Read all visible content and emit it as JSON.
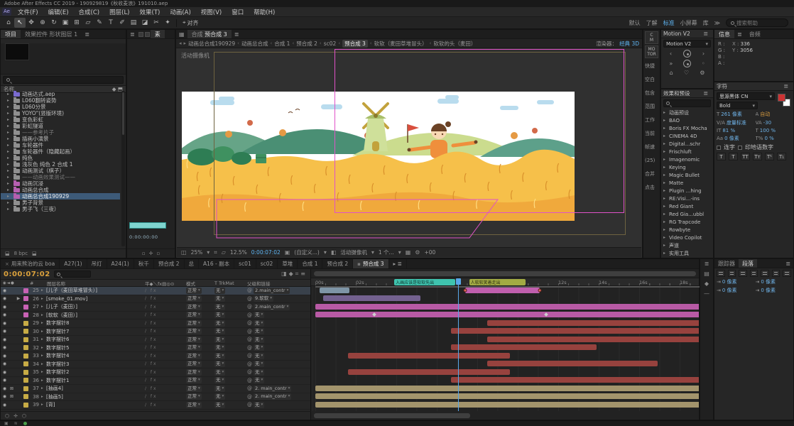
{
  "titlebar": {
    "title": "Adobe After Effects CC 2019 - 190929819《秋收麦浪》191010.aep"
  },
  "menubar": [
    "文件(F)",
    "编辑(E)",
    "合成(C)",
    "图层(L)",
    "效果(T)",
    "动画(A)",
    "视图(V)",
    "窗口",
    "帮助(H)"
  ],
  "toolbar": {
    "tools": [
      {
        "name": "home",
        "glyph": "⌂"
      },
      {
        "name": "selection",
        "glyph": "↖"
      },
      {
        "name": "hand",
        "glyph": "✥"
      },
      {
        "name": "zoom",
        "glyph": "⊕"
      },
      {
        "name": "orbit",
        "glyph": "↻"
      },
      {
        "name": "camera",
        "glyph": "▣"
      },
      {
        "name": "pan-behind",
        "glyph": "⊞"
      },
      {
        "name": "shape",
        "glyph": "▱"
      },
      {
        "name": "pen",
        "glyph": "✎"
      },
      {
        "name": "type",
        "glyph": "T"
      },
      {
        "name": "brush",
        "glyph": "✐"
      },
      {
        "name": "clone-stamp",
        "glyph": "▤"
      },
      {
        "name": "eraser",
        "glyph": "◪"
      },
      {
        "name": "roto-brush",
        "glyph": "✂"
      },
      {
        "name": "puppet",
        "glyph": "✦"
      }
    ],
    "snap_label": "对齐",
    "workspaces": [
      "默认",
      "了解",
      "标准",
      "小屏幕",
      "库"
    ],
    "active_workspace": "标准",
    "more_glyph": "≫",
    "search_placeholder": "搜索帮助"
  },
  "project": {
    "tabs": [
      {
        "label": "项目",
        "active": true
      },
      {
        "label": "效果控件 形状图层 1",
        "active": false
      }
    ],
    "name_header": "名称",
    "bitdepth": "8 bpc",
    "items": [
      {
        "name": "动画达式.aep",
        "icon": "aep"
      },
      {
        "name": "L060翻转姿势",
        "icon": "folder"
      },
      {
        "name": "L060分景",
        "icon": "folder"
      },
      {
        "name": "YOYO\"(竖版环境)",
        "icon": "folder"
      },
      {
        "name": "变色彩虹",
        "icon": "folder"
      },
      {
        "name": "彩虹隧道",
        "icon": "folder"
      },
      {
        "name": "——参考片子",
        "icon": "folder",
        "dim": true
      },
      {
        "name": "插画小演景",
        "icon": "folder"
      },
      {
        "name": "车轮器件",
        "icon": "folder"
      },
      {
        "name": "车轮器件（隐藏起画）",
        "icon": "folder"
      },
      {
        "name": "纯色",
        "icon": "folder"
      },
      {
        "name": "浅灰色 纯色 2 合成 1",
        "icon": "folder"
      },
      {
        "name": "动画测试（棋子）",
        "icon": "folder"
      },
      {
        "name": "——动画效果测试——",
        "icon": "folder",
        "dim": true
      },
      {
        "name": "动画沉浸",
        "icon": "comp"
      },
      {
        "name": "动画总合成",
        "icon": "comp"
      },
      {
        "name": "动画总合成190929",
        "icon": "comp",
        "selected": true
      },
      {
        "name": "男子背景",
        "icon": "folder"
      },
      {
        "name": "男子飞（三夜）",
        "icon": "folder"
      }
    ]
  },
  "footage": {
    "tab": "素",
    "time": "0:00:00:00"
  },
  "viewer": {
    "tab_prefix": "合成",
    "tab_name": "预合成 3",
    "breadcrumbs": [
      "动画总合成190929",
      "动画总合成",
      "合成 1",
      "预合成 2",
      "sc02",
      "预合成 3",
      "软软（麦田草堆冒头）",
      "软软的头（麦田）"
    ],
    "active_crumb": "预合成 3",
    "renderer_label": "渲染器：",
    "renderer_value": "经典 3D",
    "camera_label": "活动摄像机",
    "statusbar": {
      "zoom": "25%",
      "resolution": "12.5%",
      "time": "0:00:07:02",
      "camera_preset": "(自定义...)",
      "view_name": "活动摄像机",
      "view_count": "1 个...",
      "exposure": "+00"
    }
  },
  "motion_panel": {
    "strip_boxes": [
      "C M",
      "MO TOR"
    ],
    "title": "Motion V2",
    "preset": "Motion V2"
  },
  "preview_labels": [
    "快捷",
    "空白",
    "包含",
    "范围",
    "工作",
    "当前",
    "帧速",
    "(25)",
    "合并",
    "点击"
  ],
  "effects": {
    "title": "效果和预设",
    "groups": [
      "动画预设",
      "BAO",
      "Boris FX Mocha",
      "CINEMA 4D",
      "Digital...schr",
      "Frischluft",
      "Imagenomic",
      "Keying",
      "Magic Bullet",
      "Matte",
      "Plugin ...hing",
      "RE:Visi...-ins",
      "Red Giant",
      "Red Gia...ubbl",
      "RG Trapcode",
      "Rowbyte",
      "Video Copilot",
      "声道",
      "实用工具"
    ]
  },
  "info": {
    "tabs": [
      "信息",
      "音频"
    ],
    "channels": [
      "R :",
      "G :",
      "B :",
      "A :"
    ],
    "x_label": "X :",
    "x_value": "336",
    "y_label": "Y :",
    "y_value": "3056"
  },
  "character": {
    "title": "字符",
    "font_family": "思源黑体 CN",
    "font_style": "Bold",
    "rows": [
      {
        "li": "T",
        "lv": "261 像素",
        "ri": "A",
        "rv": "自动",
        "orange": true
      },
      {
        "li": "V/A",
        "lv": "度量标准",
        "ri": "VA",
        "rv": "-30"
      },
      {
        "li": "IT",
        "lv": "81 %",
        "ri": "T",
        "rv": "100 %"
      },
      {
        "li": "Aa",
        "lv": "0 像素",
        "ri": "T%",
        "rv": "0 %"
      }
    ],
    "checks": [
      "连字",
      "印地语数字"
    ],
    "tbuttons": [
      "T",
      "T",
      "TT",
      "Tт",
      "T¹",
      "T₁"
    ]
  },
  "paragraph": {
    "tabs": [
      "跟踪器",
      "段落"
    ],
    "fields": [
      "0 像素",
      "0 像素",
      "0 像素",
      "0 像素"
    ]
  },
  "timeline": {
    "comp_tabs": [
      {
        "label": "用来熊治的云 boa",
        "close": true
      },
      {
        "label": "A27(1)"
      },
      {
        "label": "吊灯"
      },
      {
        "label": "A24(1)"
      },
      {
        "label": "秋千"
      },
      {
        "label": "预合成 2"
      },
      {
        "label": "总"
      },
      {
        "label": "A16 - 副本"
      },
      {
        "label": "sc01"
      },
      {
        "label": "sc02"
      },
      {
        "label": "草堆"
      },
      {
        "label": "合成 1"
      },
      {
        "label": "预合成 2"
      },
      {
        "label": "预合成 3",
        "active": true
      }
    ],
    "timecode": "0:00:07:02",
    "headers": {
      "name": "图层名称",
      "switches": "平◆＼fx▤◎⊙",
      "mode": "模式",
      "trkmat": "T TrkMat",
      "parent": "父级和链接"
    },
    "layers": [
      {
        "num": 25,
        "label": "#c862b4",
        "name": "[儿子（麦田草堆冒头）]",
        "mode": "正常",
        "trkmat": "无",
        "parent": "2.main_contr",
        "selected": true
      },
      {
        "num": 26,
        "label": "#c862b4",
        "name": "[smoke_01.mov]",
        "mode": "正常",
        "trkmat": "无",
        "parent": "9.软软",
        "play": true
      },
      {
        "num": 27,
        "label": "#c862b4",
        "name": "[儿子（麦田）]",
        "mode": "正常",
        "trkmat": "无",
        "parent": "2.main_contr"
      },
      {
        "num": 28,
        "label": "#c862b4",
        "name": "[软软（麦田）]",
        "mode": "正常",
        "trkmat": "无",
        "parent": "无"
      },
      {
        "num": 29,
        "label": "#c7ab45",
        "name": "数字摆针8",
        "mode": "正常",
        "trkmat": "无",
        "parent": "无"
      },
      {
        "num": 30,
        "label": "#c7ab45",
        "name": "数字摆针7",
        "mode": "正常",
        "trkmat": "无",
        "parent": "无"
      },
      {
        "num": 31,
        "label": "#c7ab45",
        "name": "数字摆针6",
        "mode": "正常",
        "trkmat": "无",
        "parent": "无"
      },
      {
        "num": 32,
        "label": "#c7ab45",
        "name": "数字摆针5",
        "mode": "正常",
        "trkmat": "无",
        "parent": "无"
      },
      {
        "num": 33,
        "label": "#c7ab45",
        "name": "数字摆针4",
        "mode": "正常",
        "trkmat": "无",
        "parent": "无"
      },
      {
        "num": 34,
        "label": "#c7ab45",
        "name": "数字摆针3",
        "mode": "正常",
        "trkmat": "无",
        "parent": "无"
      },
      {
        "num": 35,
        "label": "#c7ab45",
        "name": "数字摆针2",
        "mode": "正常",
        "trkmat": "无",
        "parent": "无"
      },
      {
        "num": 36,
        "label": "#c7ab45",
        "name": "数字摆针1",
        "mode": "正常",
        "trkmat": "无",
        "parent": "无"
      },
      {
        "num": 37,
        "label": "#c7ab45",
        "name": "[抽画4]",
        "mode": "正常",
        "trkmat": "无",
        "parent": "2. main_contr",
        "lock": true
      },
      {
        "num": 38,
        "label": "#c7ab45",
        "name": "[抽画5]",
        "mode": "正常",
        "trkmat": "无",
        "parent": "2. main_contr",
        "lock": true
      },
      {
        "num": 39,
        "label": "#c7ab45",
        "name": "[背]",
        "mode": "正常",
        "trkmat": "无",
        "parent": "无"
      }
    ],
    "ruler_ticks": [
      "00s",
      "02s",
      "04s",
      "06s",
      "08s",
      "10s",
      "12s",
      "14s",
      "16s",
      "18s"
    ],
    "pps": 28.5,
    "playhead_s": 7.07,
    "markers": [
      {
        "start": 3.9,
        "end": 6.9,
        "color": "#3fc3ae",
        "label": "入画应该是软软先出"
      },
      {
        "start": 7.6,
        "end": 10.4,
        "color": "#a2ab43",
        "label": "人软软笑着走出"
      }
    ],
    "bars": [
      {
        "row": 0,
        "start": 0.2,
        "end": 1.7,
        "color": "#7e95a6"
      },
      {
        "row": 0,
        "start": 7.4,
        "end": 11.1,
        "color": "#c05fae",
        "kf": [
          7.4,
          11.1
        ]
      },
      {
        "row": 1,
        "start": 0.4,
        "end": 5.2,
        "color": "#73618f"
      },
      {
        "row": 2,
        "start": 0,
        "end": 19,
        "color": "#b85aa5"
      },
      {
        "row": 3,
        "start": 0,
        "end": 19,
        "color": "#b85aa5",
        "kd": [
          2.9,
          11.4
        ]
      },
      {
        "row": 4,
        "start": 8.5,
        "end": 19,
        "color": "#97423e"
      },
      {
        "row": 5,
        "start": 6.7,
        "end": 19,
        "color": "#97423e"
      },
      {
        "row": 6,
        "start": 8.5,
        "end": 19,
        "color": "#97423e"
      },
      {
        "row": 7,
        "start": 6.7,
        "end": 13.9,
        "color": "#97423e"
      },
      {
        "row": 8,
        "start": 1.6,
        "end": 9.6,
        "color": "#97423e"
      },
      {
        "row": 9,
        "start": 8.5,
        "end": 16.9,
        "color": "#97423e"
      },
      {
        "row": 10,
        "start": 1.6,
        "end": 9.6,
        "color": "#97423e"
      },
      {
        "row": 11,
        "start": 6.7,
        "end": 19,
        "color": "#97423e"
      },
      {
        "row": 12,
        "start": 0,
        "end": 19,
        "color": "#a3946c"
      },
      {
        "row": 13,
        "start": 0,
        "end": 19,
        "color": "#a3946c"
      },
      {
        "row": 14,
        "start": 0,
        "end": 19,
        "color": "#a3946c"
      }
    ]
  },
  "scene": {
    "sky": "#ffffff",
    "cloud": "#b9dcee",
    "hill_teal": "#66a487",
    "hill_dark": "#4a8f74",
    "hill_light": "#cbdc8e",
    "hill_teal2": "#5da08a",
    "tree_orange": "#e59a44",
    "tree_red": "#d26a4a",
    "wheat": "#f6c04a",
    "wheat_front": "#f0a93c",
    "wheat_dark": "#d98f2a",
    "wheat_light": "#ffdd82",
    "bush": "#2e7d54",
    "bush2": "#3f9160",
    "crate": "#3f9160",
    "crate_dark": "#2a6b44",
    "windmill_body": "#cfe09a",
    "windmill_cap": "#a8bf6a",
    "windmill_blade": "#c2a23c",
    "windmill_hub": "#8a7a2e",
    "windmill_door": "#c2a23c",
    "flag_red": "#d94f3e",
    "boy_shirt": "#ef8f3c",
    "boy_skin": "#f8d9b4",
    "boy_hair": "#6b4226",
    "outline": "#e052c8"
  }
}
